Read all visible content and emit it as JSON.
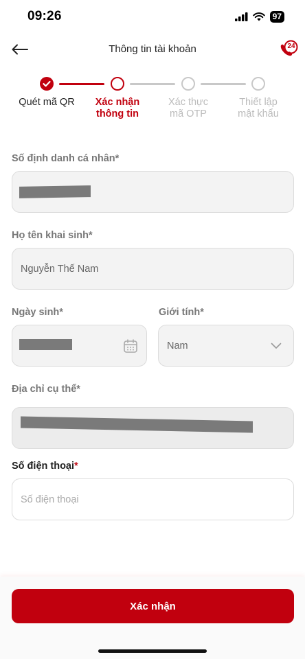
{
  "status": {
    "time": "09:26",
    "battery": "97"
  },
  "nav": {
    "title": "Thông tin tài khoản",
    "support_badge": "24"
  },
  "stepper": {
    "steps": [
      {
        "line1": "Quét mã QR",
        "line2": "",
        "state": "done"
      },
      {
        "line1": "Xác nhận",
        "line2": "thông tin",
        "state": "current"
      },
      {
        "line1": "Xác thực",
        "line2": "mã OTP",
        "state": "pending"
      },
      {
        "line1": "Thiết lập",
        "line2": "mật khẩu",
        "state": "pending"
      }
    ]
  },
  "form": {
    "id_number": {
      "label": "Số định danh cá nhân",
      "required_mark": "*"
    },
    "birth_name": {
      "label": "Họ tên khai sinh",
      "required_mark": "*",
      "value": "Nguyễn Thế Nam"
    },
    "dob": {
      "label": "Ngày sinh",
      "required_mark": "*"
    },
    "gender": {
      "label": "Giới tính",
      "required_mark": "*",
      "value": "Nam"
    },
    "address": {
      "label": "Địa chỉ cụ thể",
      "required_mark": "*"
    },
    "phone": {
      "label": "Số điện thoại",
      "required_mark": "*",
      "placeholder": "Số điện thoại"
    }
  },
  "actions": {
    "confirm_label": "Xác nhận"
  },
  "colors": {
    "brand": "#c1000e",
    "muted": "#c8c8c8"
  }
}
